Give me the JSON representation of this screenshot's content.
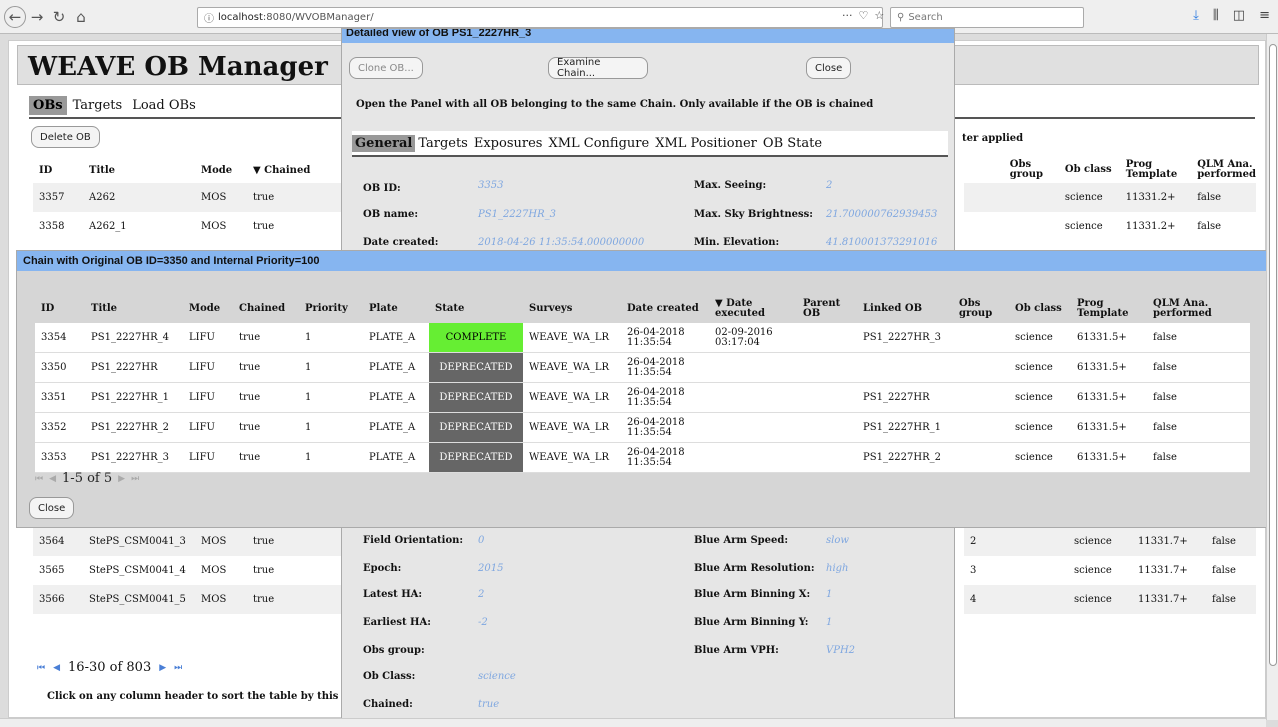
{
  "browser": {
    "url_host": "localhost",
    "url_path": ":8080/WVOBManager/",
    "search_placeholder": "Search",
    "url_menu": "···"
  },
  "app": {
    "title": "WEAVE OB Manager",
    "tabs": [
      "OBs",
      "Targets",
      "Load OBs"
    ],
    "delete_label": "Delete OB",
    "filter_text": "ter applied"
  },
  "bg_table": {
    "headers": [
      "ID",
      "Title",
      "Mode",
      "▼ Chained"
    ],
    "right_headers": [
      "Obs group",
      "Ob class",
      "Prog Template",
      "QLM Ana. performed"
    ],
    "top_rows": [
      {
        "id": "3357",
        "title": "A262",
        "mode": "MOS",
        "chained": "true",
        "cls": "science",
        "prog": "11331.2+",
        "qlm": "false"
      },
      {
        "id": "3358",
        "title": "A262_1",
        "mode": "MOS",
        "chained": "true",
        "cls": "science",
        "prog": "11331.2+",
        "qlm": "false"
      }
    ],
    "bottom_rows": [
      {
        "id": "3564",
        "title": "StePS_CSM0041_3",
        "mode": "MOS",
        "chained": "true",
        "grp": "2",
        "cls": "science",
        "prog": "11331.7+",
        "qlm": "false"
      },
      {
        "id": "3565",
        "title": "StePS_CSM0041_4",
        "mode": "MOS",
        "chained": "true",
        "grp": "3",
        "cls": "science",
        "prog": "11331.7+",
        "qlm": "false"
      },
      {
        "id": "3566",
        "title": "StePS_CSM0041_5",
        "mode": "MOS",
        "chained": "true",
        "grp": "4",
        "cls": "science",
        "prog": "11331.7+",
        "qlm": "false"
      }
    ],
    "pager": "16-30 of 803",
    "hint": "Click on any column header to sort the table by this colun"
  },
  "detail": {
    "title": "Detailed view of OB PS1_2227HR_3",
    "clone_label": "Clone OB...",
    "examine_label": "Examine Chain...",
    "close_label": "Close",
    "desc": "Open the Panel with all OB belonging to the same Chain. Only available if the OB is chained",
    "tabs": [
      "General",
      "Targets",
      "Exposures",
      "XML Configure",
      "XML Positioner",
      "OB State"
    ],
    "left_fields": [
      {
        "label": "OB ID:",
        "value": "3353"
      },
      {
        "label": "OB name:",
        "value": "PS1_2227HR_3"
      },
      {
        "label": "Date created:",
        "value": "2018-04-26 11:35:54.000000000"
      }
    ],
    "right_fields": [
      {
        "label": "Max. Seeing:",
        "value": "2"
      },
      {
        "label": "Max. Sky Brightness:",
        "value": "21.700000762939453"
      },
      {
        "label": "Min. Elevation:",
        "value": "41.810001373291016"
      }
    ],
    "left_fields2": [
      {
        "label": "Field Orientation:",
        "value": "0"
      },
      {
        "label": "Epoch:",
        "value": "2015"
      },
      {
        "label": "Latest HA:",
        "value": "2"
      },
      {
        "label": "Earliest HA:",
        "value": "-2"
      },
      {
        "label": "Obs group:",
        "value": ""
      },
      {
        "label": "Ob Class:",
        "value": "science"
      },
      {
        "label": "Chained:",
        "value": "true"
      }
    ],
    "right_fields2": [
      {
        "label": "Blue Arm Speed:",
        "value": "slow"
      },
      {
        "label": "Blue Arm Resolution:",
        "value": "high"
      },
      {
        "label": "Blue Arm Binning X:",
        "value": "1"
      },
      {
        "label": "Blue Arm Binning Y:",
        "value": "1"
      },
      {
        "label": "Blue Arm VPH:",
        "value": "VPH2"
      }
    ]
  },
  "chain": {
    "title": "Chain with Original OB ID=3350 and Internal Priority=100",
    "headers": [
      "ID",
      "Title",
      "Mode",
      "Chained",
      "Priority",
      "Plate",
      "State",
      "Surveys",
      "Date created",
      "▼ Date executed",
      "Parent OB",
      "Linked OB",
      "Obs group",
      "Ob class",
      "Prog Template",
      "QLM Ana. performed"
    ],
    "rows": [
      {
        "id": "3354",
        "title": "PS1_2227HR_4",
        "mode": "LIFU",
        "chained": "true",
        "priority": "1",
        "plate": "PLATE_A",
        "state": "COMPLETE",
        "surveys": "WEAVE_WA_LR",
        "created": "26-04-2018 11:35:54",
        "executed": "02-09-2016 03:17:04",
        "parent": "",
        "linked": "PS1_2227HR_3",
        "grp": "",
        "cls": "science",
        "prog": "61331.5+",
        "qlm": "false"
      },
      {
        "id": "3350",
        "title": "PS1_2227HR",
        "mode": "LIFU",
        "chained": "true",
        "priority": "1",
        "plate": "PLATE_A",
        "state": "DEPRECATED",
        "surveys": "WEAVE_WA_LR",
        "created": "26-04-2018 11:35:54",
        "executed": "",
        "parent": "",
        "linked": "",
        "grp": "",
        "cls": "science",
        "prog": "61331.5+",
        "qlm": "false"
      },
      {
        "id": "3351",
        "title": "PS1_2227HR_1",
        "mode": "LIFU",
        "chained": "true",
        "priority": "1",
        "plate": "PLATE_A",
        "state": "DEPRECATED",
        "surveys": "WEAVE_WA_LR",
        "created": "26-04-2018 11:35:54",
        "executed": "",
        "parent": "",
        "linked": "PS1_2227HR",
        "grp": "",
        "cls": "science",
        "prog": "61331.5+",
        "qlm": "false"
      },
      {
        "id": "3352",
        "title": "PS1_2227HR_2",
        "mode": "LIFU",
        "chained": "true",
        "priority": "1",
        "plate": "PLATE_A",
        "state": "DEPRECATED",
        "surveys": "WEAVE_WA_LR",
        "created": "26-04-2018 11:35:54",
        "executed": "",
        "parent": "",
        "linked": "PS1_2227HR_1",
        "grp": "",
        "cls": "science",
        "prog": "61331.5+",
        "qlm": "false"
      },
      {
        "id": "3353",
        "title": "PS1_2227HR_3",
        "mode": "LIFU",
        "chained": "true",
        "priority": "1",
        "plate": "PLATE_A",
        "state": "DEPRECATED",
        "surveys": "WEAVE_WA_LR",
        "created": "26-04-2018 11:35:54",
        "executed": "",
        "parent": "",
        "linked": "PS1_2227HR_2",
        "grp": "",
        "cls": "science",
        "prog": "61331.5+",
        "qlm": "false"
      }
    ],
    "pager": "1-5 of 5",
    "close_label": "Close"
  }
}
